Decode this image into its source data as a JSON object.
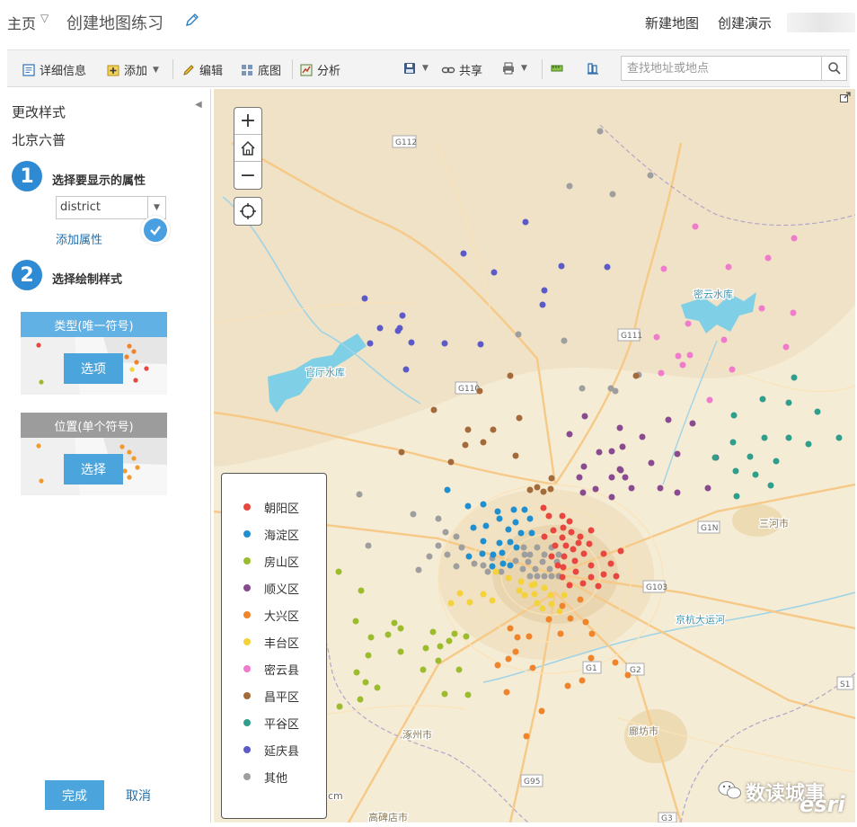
{
  "header": {
    "home_label": "主页",
    "map_title": "创建地图练习",
    "new_map_label": "新建地图",
    "create_presentation_label": "创建演示"
  },
  "toolbar": {
    "details_label": "详细信息",
    "add_label": "添加",
    "edit_label": "编辑",
    "basemap_label": "底图",
    "analysis_label": "分析",
    "share_label": "共享",
    "search_placeholder": "查找地址或地点"
  },
  "panel": {
    "title": "更改样式",
    "layer_name": "北京六普",
    "step1_number": "1",
    "step1_label": "选择要显示的属性",
    "attribute_value": "district",
    "add_attribute_label": "添加属性",
    "step2_number": "2",
    "step2_label": "选择绘制样式",
    "style_unique": {
      "title": "类型(唯一符号)",
      "button": "选项"
    },
    "style_single": {
      "title": "位置(单个符号)",
      "button": "选择"
    },
    "done_label": "完成",
    "cancel_label": "取消"
  },
  "map": {
    "place_labels": {
      "miyun_reservoir": "密云水库",
      "guanting_reservoir": "官厅水库",
      "sanhe": "三河市",
      "zhuozhou": "涿州市",
      "langfang": "廊坊市",
      "gaobeidian": "高碑店市",
      "jinghang_canal": "京杭大运河",
      "partial_cm": "cm"
    },
    "road_shields": [
      "G112",
      "G111",
      "G110",
      "G1N",
      "G103",
      "G2",
      "G1",
      "G95",
      "G3",
      "S1"
    ]
  },
  "legend": {
    "items": [
      {
        "label": "朝阳区",
        "color": "#e8463f"
      },
      {
        "label": "海淀区",
        "color": "#1f8fd0"
      },
      {
        "label": "房山区",
        "color": "#9cbc2e"
      },
      {
        "label": "顺义区",
        "color": "#8a4a90"
      },
      {
        "label": "大兴区",
        "color": "#f0842a"
      },
      {
        "label": "丰台区",
        "color": "#f4d23a"
      },
      {
        "label": "密云县",
        "color": "#f07bcc"
      },
      {
        "label": "昌平区",
        "color": "#a46a3a"
      },
      {
        "label": "平谷区",
        "color": "#2f9e8c"
      },
      {
        "label": "延庆县",
        "color": "#5b5ac8"
      },
      {
        "label": "其他",
        "color": "#9e9e9e"
      }
    ]
  },
  "watermark": {
    "text": "数读城事",
    "brand": "esri"
  }
}
